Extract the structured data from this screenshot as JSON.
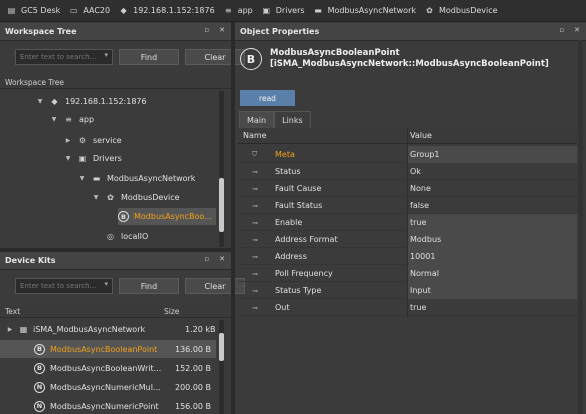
{
  "breadcrumb": [
    {
      "icon": "station-icon",
      "label": "GC5 Desk"
    },
    {
      "icon": "folder-icon",
      "label": "AAC20"
    },
    {
      "icon": "server-icon",
      "label": "192.168.1.152:1876"
    },
    {
      "icon": "app-icon",
      "label": "app"
    },
    {
      "icon": "drivers-icon",
      "label": "Drivers"
    },
    {
      "icon": "network-icon",
      "label": "ModbusAsyncNetwork"
    },
    {
      "icon": "device-icon",
      "label": "ModbusDevice"
    }
  ],
  "workspace": {
    "title": "Workspace Tree",
    "search_placeholder": "Enter text to search...",
    "find_label": "Find",
    "clear_label": "Clear",
    "subheader": "Workspace Tree",
    "nodes": [
      {
        "label": "192.168.1.152:1876",
        "icon": "server-icon"
      },
      {
        "label": "app",
        "icon": "app-icon"
      },
      {
        "label": "service",
        "icon": "gear-icon"
      },
      {
        "label": "Drivers",
        "icon": "drivers-icon"
      },
      {
        "label": "ModbusAsyncNetwork",
        "icon": "network-icon"
      },
      {
        "label": "ModbusDevice",
        "icon": "device-icon"
      },
      {
        "label": "ModbusAsyncBoo...",
        "icon": "boolean-point-icon"
      },
      {
        "label": "localIO",
        "icon": "localio-icon"
      }
    ]
  },
  "kits": {
    "title": "Device Kits",
    "search_placeholder": "Enter text to search...",
    "find_label": "Find",
    "clear_label": "Clear",
    "col_text": "Text",
    "col_size": "Size",
    "rows": [
      {
        "label": "iSMA_ModbusAsyncNetwork",
        "size": "1.20 kB",
        "badge": ""
      },
      {
        "label": "ModbusAsyncBooleanPoint",
        "size": "136.00 B",
        "badge": "B"
      },
      {
        "label": "ModbusAsyncBooleanWrit...",
        "size": "152.00 B",
        "badge": "B"
      },
      {
        "label": "ModbusAsyncNumericMul...",
        "size": "200.00 B",
        "badge": "N"
      },
      {
        "label": "ModbusAsyncNumericPoint",
        "size": "156.00 B",
        "badge": "N"
      }
    ]
  },
  "object": {
    "panel_title": "Object Properties",
    "badge": "B",
    "name": "ModbusAsyncBooleanPoint",
    "type": "[iSMA_ModbusAsyncNetwork::ModbusAsyncBooleanPoint]",
    "read_label": "read",
    "tabs": [
      "Main",
      "Links"
    ],
    "col_name": "Name",
    "col_value": "Value",
    "properties": [
      {
        "name": "Meta",
        "value": "Group1"
      },
      {
        "name": "Status",
        "value": "Ok"
      },
      {
        "name": "Fault Cause",
        "value": "None"
      },
      {
        "name": "Fault Status",
        "value": "false"
      },
      {
        "name": "Enable",
        "value": "true"
      },
      {
        "name": "Address Format",
        "value": "Modbus"
      },
      {
        "name": "Address",
        "value": "10001"
      },
      {
        "name": "Poll Frequency",
        "value": "Normal"
      },
      {
        "name": "Status Type",
        "value": "Input"
      },
      {
        "name": "Out",
        "value": "true"
      }
    ]
  },
  "colors": {
    "accent": "#f0a11a",
    "read_button": "#5a7fa8",
    "background": "#3b3b3b"
  }
}
